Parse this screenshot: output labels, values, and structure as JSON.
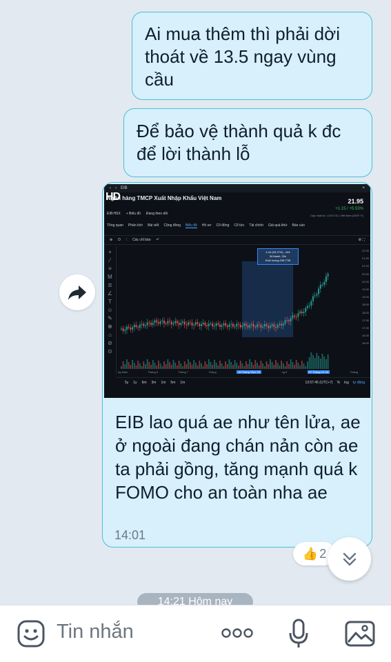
{
  "messages": [
    {
      "id": "b1",
      "text": "Ai mua thêm thì phải dời thoát về 13.5 ngay vùng cầu"
    },
    {
      "id": "b2",
      "text": "Để bảo vệ thành quả k đc để lời thành lỗ"
    },
    {
      "id": "b3",
      "caption": "EIB lao quá ae như tên lửa, ae ở ngoài đang chán nản còn ae ta phải gồng, tăng mạnh quá k FOMO cho an toàn nha ae",
      "time": "14:01"
    }
  ],
  "chart_image": {
    "window_label": "EIB",
    "watermark": "HD",
    "company": "Ngân hàng TMCP Xuất Nhập Khẩu Việt Nam",
    "ticker": "EIB:HSX",
    "ticker_btn": "+ Biểu đồ",
    "follow_btn": "Đang theo dõi",
    "price": "21.95",
    "change": "+1.15 / +5.53%",
    "updated": "Cập nhật lúc: 13:57:41 | Việt Nam (GMT+7)",
    "nav_tabs": [
      "Tổng quan",
      "Phân tích",
      "Bài viết",
      "Cộng đồng",
      "Biểu đồ",
      "Hồ sơ",
      "Cổ đông",
      "Cổ tức",
      "Tài chính",
      "Giá quá khứ",
      "Báo cáo"
    ],
    "toolbar": {
      "interval": "D",
      "indicators": "Các chỉ báo"
    },
    "tooltip": [
      "4.44 (25.17%) , 444",
      "34 thanh, 32n",
      "Khối lượng 235.77M"
    ],
    "y_axis": [
      "22.00",
      "21.50",
      "21.00",
      "20.50",
      "20.00",
      "19.50",
      "19.00",
      "18.50",
      "18.00",
      "17.50",
      "17.00",
      "16.50",
      "16.00"
    ],
    "months": [
      "ng Năm",
      "Tháng 6",
      "Tháng 7",
      "Tháng",
      "16 Tháng Tám '24",
      "ng 9",
      "07 Tháng 10 '24",
      "Tháng"
    ],
    "ranges": [
      "5y",
      "1y",
      "6m",
      "3m",
      "1m",
      "5m",
      "1m"
    ],
    "clock": "13:57:45 (UTC+7)",
    "scale_opts": [
      "%",
      "log",
      "tự động"
    ]
  },
  "reaction": {
    "emoji": "👍",
    "count": "2"
  },
  "date_pill": "14:21 Hôm nay",
  "composer": {
    "placeholder": "Tin nhắn"
  },
  "colors": {
    "bubble": "#d7f0fb",
    "border": "#46c0d6",
    "up": "#26a69a",
    "down": "#ef5350"
  }
}
